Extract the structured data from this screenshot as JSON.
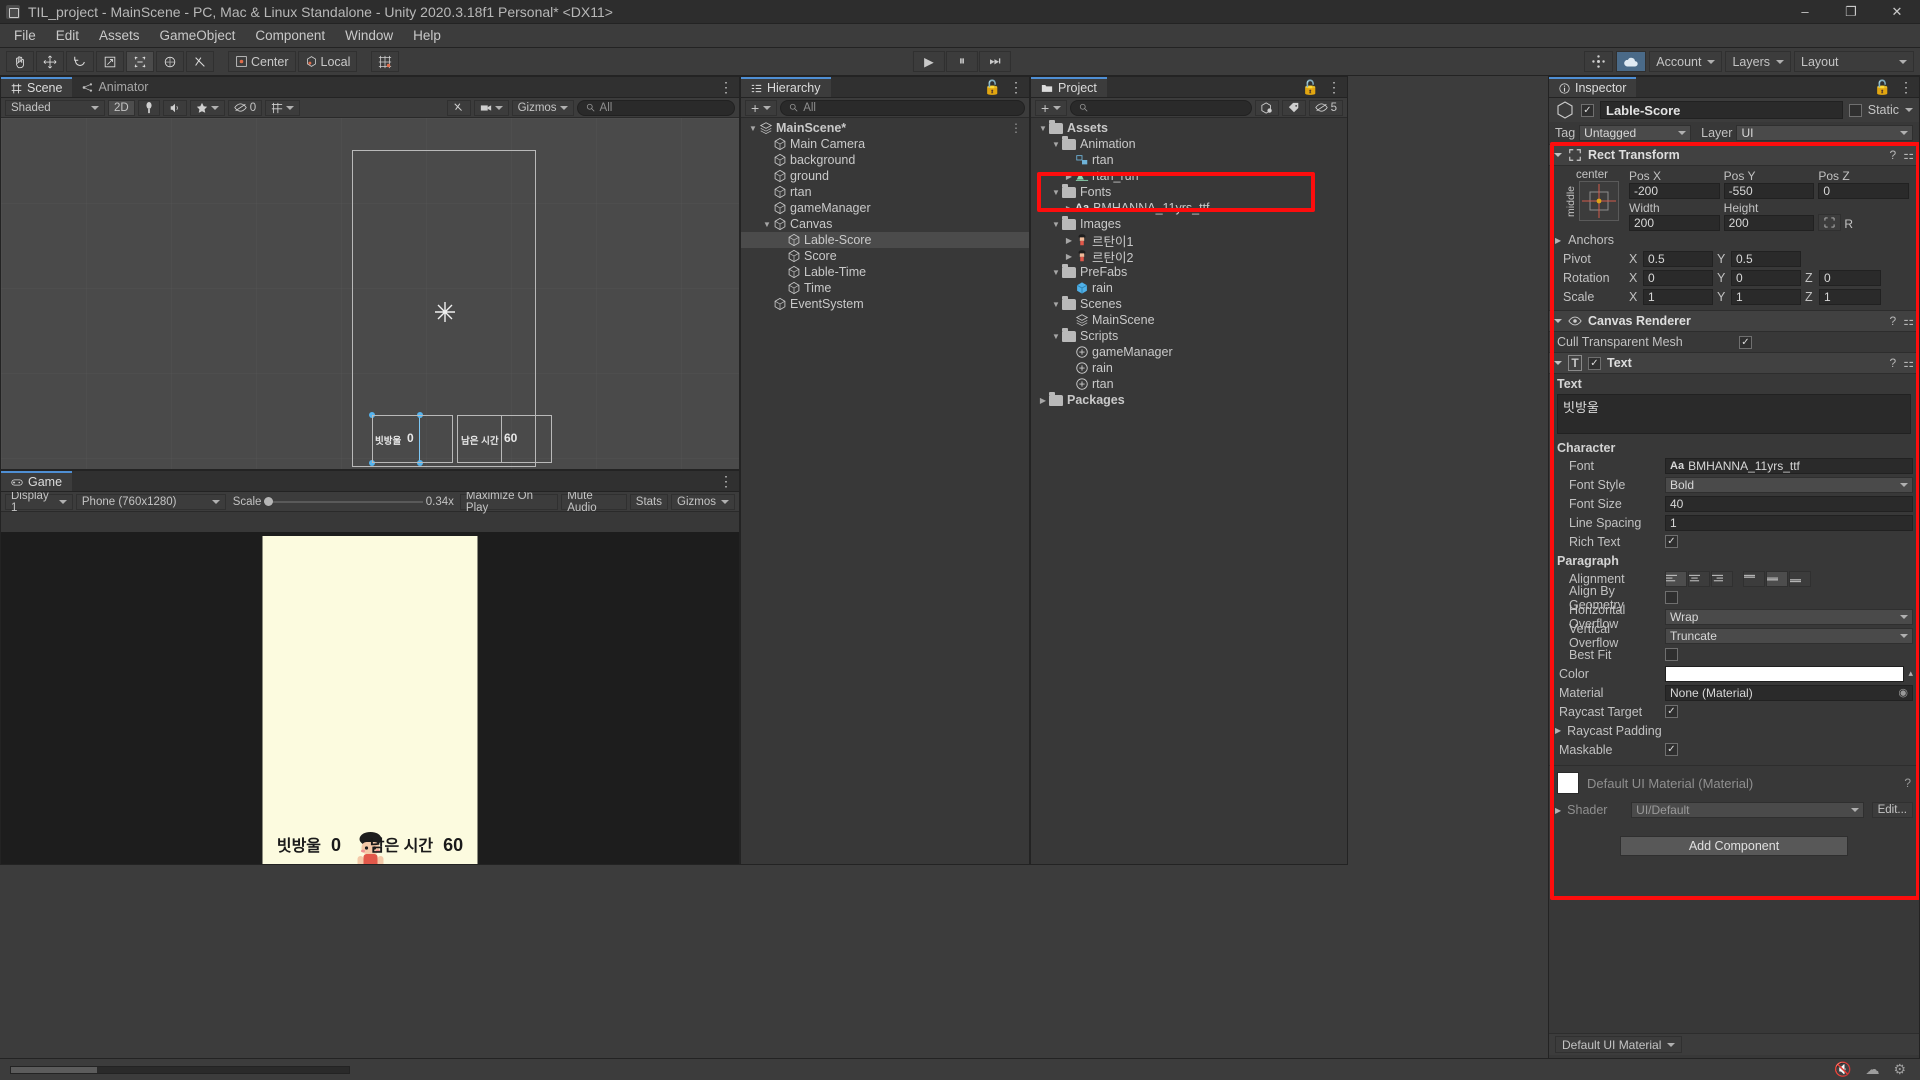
{
  "window": {
    "title": "TIL_project - MainScene - PC, Mac & Linux Standalone - Unity 2020.3.18f1 Personal* <DX11>",
    "minimize": "–",
    "maximize": "❐",
    "close": "✕"
  },
  "menubar": {
    "items": [
      "File",
      "Edit",
      "Assets",
      "GameObject",
      "Component",
      "Window",
      "Help"
    ]
  },
  "toolbar": {
    "tools": [
      "hand-tool",
      "move-tool",
      "rotate-tool",
      "scale-tool",
      "rect-tool",
      "transform-tool",
      "custom-tool"
    ],
    "pivot_mode": "Center",
    "pivot_rotation": "Local",
    "grid_label": "",
    "play": "▶",
    "pause": "⏸",
    "step": "⏭",
    "collab": "Collab",
    "cloud": "cloud",
    "account": "Account",
    "layers": "Layers",
    "layout": "Layout"
  },
  "scene_panel": {
    "tabs": [
      {
        "label": "Scene",
        "active": true
      },
      {
        "label": "Animator",
        "active": false
      }
    ],
    "shading": "Shaded",
    "mode_2d": "2D",
    "audio_count": "0",
    "gizmos": "Gizmos",
    "search_placeholder": "All",
    "overlay_labels": [
      "빗방울",
      "0",
      "남은 시간",
      "60"
    ]
  },
  "game_panel": {
    "tab": "Game",
    "display": "Display 1",
    "resolution": "Phone (760x1280)",
    "scale_label": "Scale",
    "scale_value": "0.34x",
    "maximize": "Maximize On Play",
    "mute": "Mute Audio",
    "stats": "Stats",
    "gizmos": "Gizmos",
    "hud": {
      "score_label": "빗방울",
      "score_value": "0",
      "time_label": "남은 시간",
      "time_value": "60"
    }
  },
  "hierarchy": {
    "tab": "Hierarchy",
    "add_label": "+",
    "search_placeholder": "All",
    "items": [
      {
        "label": "MainScene*",
        "depth": 0,
        "icon": "scene-icon",
        "arrow": "down",
        "selected": false,
        "menu": true
      },
      {
        "label": "Main Camera",
        "depth": 1,
        "icon": "gameobject-icon",
        "arrow": "",
        "selected": false
      },
      {
        "label": "background",
        "depth": 1,
        "icon": "gameobject-icon",
        "arrow": "",
        "selected": false
      },
      {
        "label": "ground",
        "depth": 1,
        "icon": "gameobject-icon",
        "arrow": "",
        "selected": false
      },
      {
        "label": "rtan",
        "depth": 1,
        "icon": "gameobject-icon",
        "arrow": "",
        "selected": false
      },
      {
        "label": "gameManager",
        "depth": 1,
        "icon": "gameobject-icon",
        "arrow": "",
        "selected": false
      },
      {
        "label": "Canvas",
        "depth": 1,
        "icon": "gameobject-icon",
        "arrow": "down",
        "selected": false
      },
      {
        "label": "Lable-Score",
        "depth": 2,
        "icon": "gameobject-icon",
        "arrow": "",
        "selected": true
      },
      {
        "label": "Score",
        "depth": 2,
        "icon": "gameobject-icon",
        "arrow": "",
        "selected": false
      },
      {
        "label": "Lable-Time",
        "depth": 2,
        "icon": "gameobject-icon",
        "arrow": "",
        "selected": false
      },
      {
        "label": "Time",
        "depth": 2,
        "icon": "gameobject-icon",
        "arrow": "",
        "selected": false
      },
      {
        "label": "EventSystem",
        "depth": 1,
        "icon": "gameobject-icon",
        "arrow": "",
        "selected": false
      }
    ]
  },
  "project": {
    "tab": "Project",
    "add_label": "+",
    "search_placeholder": "",
    "hidden_count": "5",
    "items": [
      {
        "label": "Assets",
        "depth": 0,
        "icon": "folder-icon",
        "arrow": "down",
        "bold": true
      },
      {
        "label": "Animation",
        "depth": 1,
        "icon": "folder-icon",
        "arrow": "down"
      },
      {
        "label": "rtan",
        "depth": 2,
        "icon": "animator-icon",
        "arrow": ""
      },
      {
        "label": "rtan_run",
        "depth": 2,
        "icon": "animation-icon",
        "arrow": "right"
      },
      {
        "label": "Fonts",
        "depth": 1,
        "icon": "folder-icon",
        "arrow": "down",
        "highlight": true
      },
      {
        "label": "BMHANNA_11yrs_ttf",
        "depth": 2,
        "icon": "font-icon",
        "arrow": "right",
        "highlight": true
      },
      {
        "label": "Images",
        "depth": 1,
        "icon": "folder-icon",
        "arrow": "down"
      },
      {
        "label": "르탄이1",
        "depth": 2,
        "icon": "sprite-icon",
        "arrow": "right"
      },
      {
        "label": "르탄이2",
        "depth": 2,
        "icon": "sprite-icon",
        "arrow": "right"
      },
      {
        "label": "PreFabs",
        "depth": 1,
        "icon": "folder-icon",
        "arrow": "down"
      },
      {
        "label": "rain",
        "depth": 2,
        "icon": "prefab-icon",
        "arrow": ""
      },
      {
        "label": "Scenes",
        "depth": 1,
        "icon": "folder-icon",
        "arrow": "down"
      },
      {
        "label": "MainScene",
        "depth": 2,
        "icon": "scene-icon",
        "arrow": ""
      },
      {
        "label": "Scripts",
        "depth": 1,
        "icon": "folder-icon",
        "arrow": "down"
      },
      {
        "label": "gameManager",
        "depth": 2,
        "icon": "script-icon",
        "arrow": ""
      },
      {
        "label": "rain",
        "depth": 2,
        "icon": "script-icon",
        "arrow": ""
      },
      {
        "label": "rtan",
        "depth": 2,
        "icon": "script-icon",
        "arrow": ""
      },
      {
        "label": "Packages",
        "depth": 0,
        "icon": "folder-icon",
        "arrow": "right",
        "bold": true
      }
    ]
  },
  "inspector": {
    "tab": "Inspector",
    "object_name": "Lable-Score",
    "enabled": true,
    "static_label": "Static",
    "tag_label": "Tag",
    "tag_value": "Untagged",
    "layer_label": "Layer",
    "layer_value": "UI",
    "rect_transform": {
      "title": "Rect Transform",
      "anchor_preset_top": "center",
      "anchor_preset_side": "middle",
      "pos_x_label": "Pos X",
      "pos_x": "-200",
      "pos_y_label": "Pos Y",
      "pos_y": "-550",
      "pos_z_label": "Pos Z",
      "pos_z": "0",
      "width_label": "Width",
      "width": "200",
      "height_label": "Height",
      "height": "200",
      "blueprint_label": "R",
      "anchors_label": "Anchors",
      "pivot_label": "Pivot",
      "pivot_x": "0.5",
      "pivot_y": "0.5",
      "rotation_label": "Rotation",
      "rot_x": "0",
      "rot_y": "0",
      "rot_z": "0",
      "scale_label": "Scale",
      "scale_x": "1",
      "scale_y": "1",
      "scale_z": "1"
    },
    "canvas_renderer": {
      "title": "Canvas Renderer",
      "cull_label": "Cull Transparent Mesh",
      "cull_checked": true
    },
    "text_component": {
      "title": "Text",
      "enabled": true,
      "text_label": "Text",
      "text_value": "빗방울",
      "character_section": "Character",
      "font_label": "Font",
      "font_value": "BMHANNA_11yrs_ttf",
      "font_style_label": "Font Style",
      "font_style_value": "Bold",
      "font_size_label": "Font Size",
      "font_size_value": "40",
      "line_spacing_label": "Line Spacing",
      "line_spacing_value": "1",
      "rich_text_label": "Rich Text",
      "rich_text_checked": true,
      "paragraph_section": "Paragraph",
      "alignment_label": "Alignment",
      "align_by_geometry_label": "Align By Geometry",
      "align_by_geometry_checked": false,
      "horizontal_overflow_label": "Horizontal Overflow",
      "horizontal_overflow_value": "Wrap",
      "vertical_overflow_label": "Vertical Overflow",
      "vertical_overflow_value": "Truncate",
      "best_fit_label": "Best Fit",
      "best_fit_checked": false,
      "color_label": "Color",
      "color_value": "#ffffff",
      "material_label": "Material",
      "material_value": "None (Material)",
      "raycast_target_label": "Raycast Target",
      "raycast_target_checked": true,
      "raycast_padding_label": "Raycast Padding",
      "maskable_label": "Maskable",
      "maskable_checked": true
    },
    "material_block": {
      "title": "Default UI Material (Material)",
      "shader_label": "Shader",
      "shader_value": "UI/Default",
      "edit_label": "Edit..."
    },
    "add_component": "Add Component",
    "footer_material": "Default UI Material"
  },
  "colors": {
    "highlight_red": "#fd0d0d",
    "tab_accent": "#4f8fd4",
    "selection": "#4b4b4b",
    "panel_bg": "#383838",
    "chrome_bg": "#3c3c3c"
  }
}
